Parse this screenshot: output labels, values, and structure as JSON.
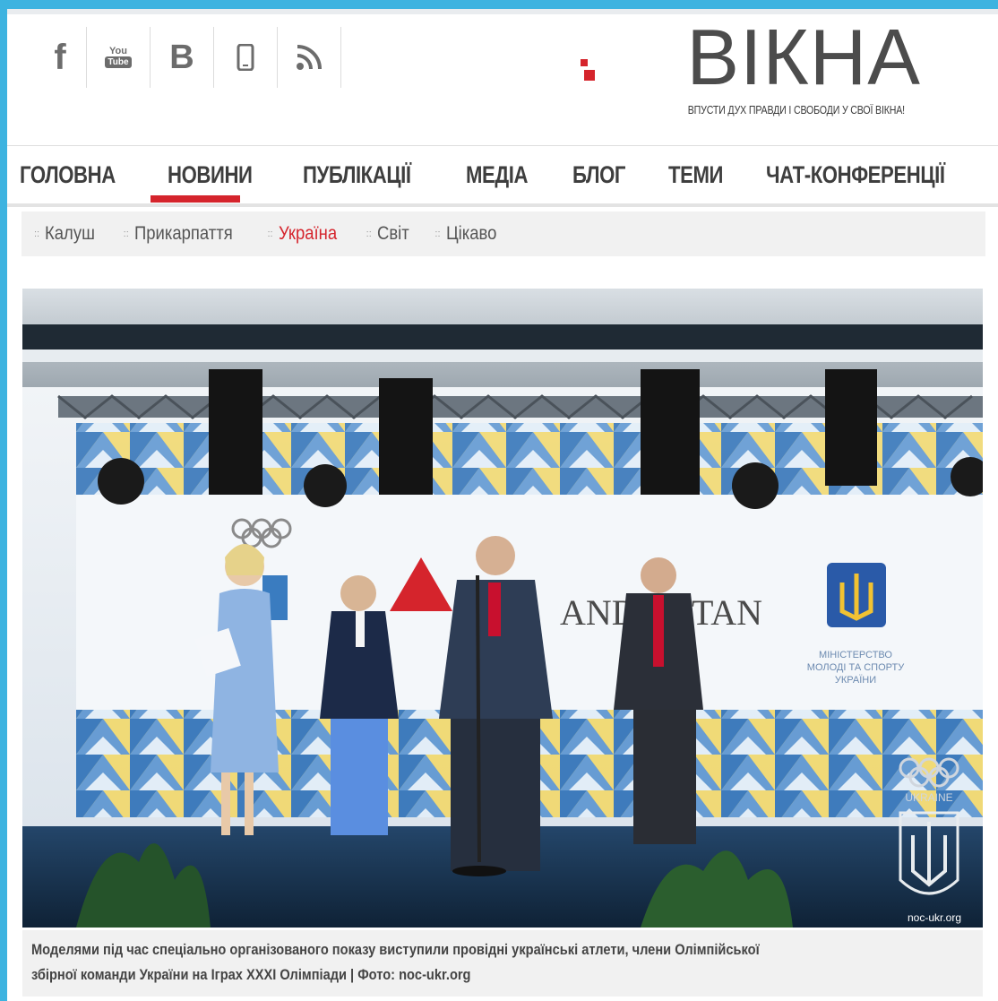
{
  "social": {
    "items": [
      {
        "name": "facebook",
        "glyph": "f"
      },
      {
        "name": "youtube",
        "glyph_top": "You",
        "glyph_bottom": "Tube"
      },
      {
        "name": "vkontakte",
        "glyph": "B"
      },
      {
        "name": "mobile",
        "glyph": ""
      },
      {
        "name": "rss",
        "glyph": ""
      }
    ]
  },
  "brand": {
    "logo": "ВІКНА",
    "slogan": "ВПУСТИ ДУХ ПРАВДИ І СВОБОДИ У СВОЇ ВІКНА!",
    "accent": "#d5242c"
  },
  "mainnav": {
    "items": [
      "ГОЛОВНА",
      "НОВИНИ",
      "ПУБЛІКАЦІЇ",
      "МЕДІА",
      "БЛОГ",
      "ТЕМИ",
      "ЧАТ-КОНФЕРЕНЦІЇ"
    ],
    "active": "НОВИНИ"
  },
  "subnav": {
    "items": [
      "Калуш",
      "Прикарпаття",
      "Україна",
      "Світ",
      "Цікаво"
    ],
    "active": "Україна",
    "bullet": "::"
  },
  "photo": {
    "watermark": "noc-ukr.org",
    "backdrop_text": "ANDRE TAN",
    "ministry_text": [
      "МІНІСТЕРСТВО",
      "МОЛОДІ ТА СПОРТУ",
      "УКРАЇНИ"
    ],
    "noc_label": "UKRAINE"
  },
  "caption": {
    "line1": "Моделями під час спеціально організованого показу виступили провідні українські атлети, члени Олімпійської",
    "line2": "збірної команди України на Іграх ХХХІ Олімпіади | Фото: noc-ukr.org"
  }
}
